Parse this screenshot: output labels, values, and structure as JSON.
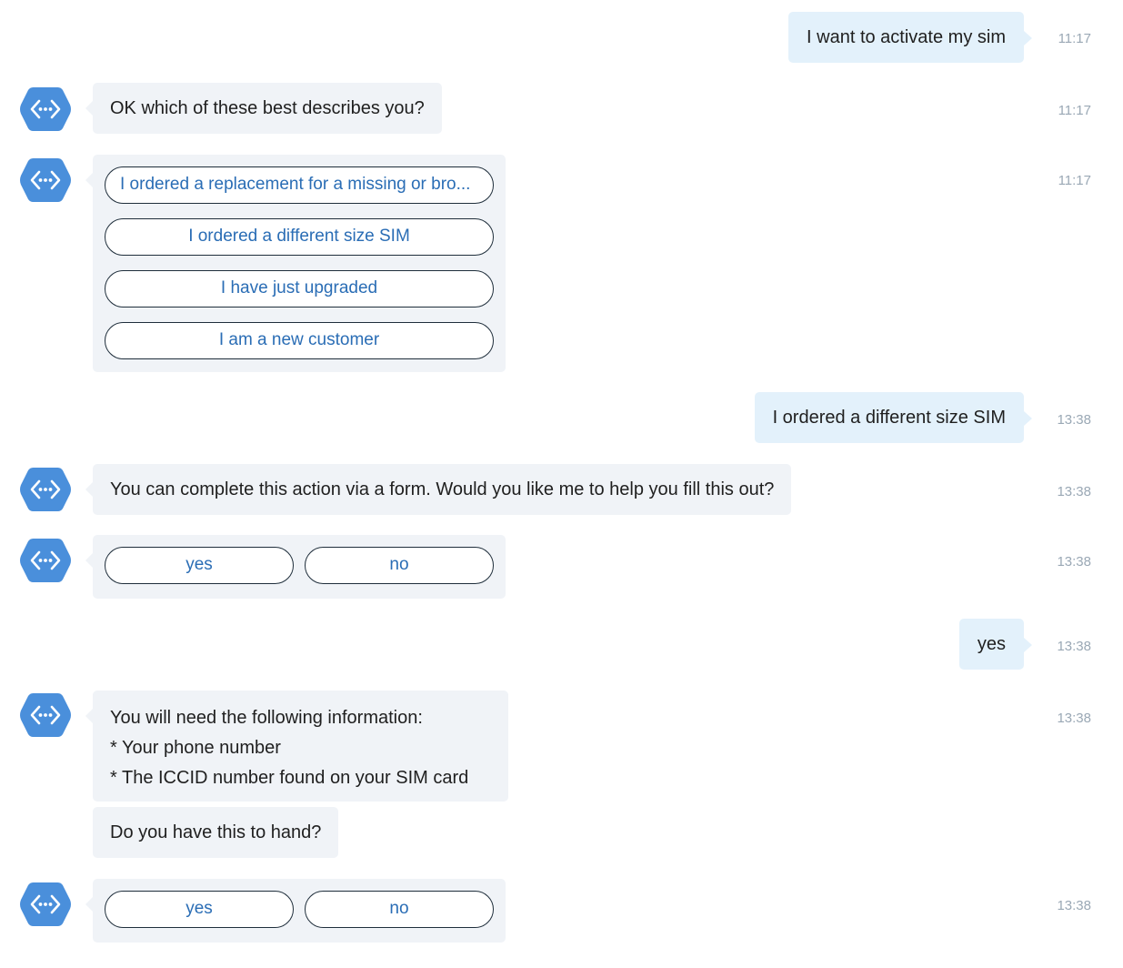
{
  "messages": {
    "m1": {
      "text": "I want to activate my sim",
      "time": "11:17"
    },
    "m2": {
      "text": "OK  which of these best describes you?",
      "time": "11:17"
    },
    "m3": {
      "time": "11:17",
      "options": [
        "I ordered a replacement for a missing or bro...",
        "I ordered a different size SIM",
        "I have just upgraded",
        "I am a new customer"
      ]
    },
    "m4": {
      "text": "I ordered a different size SIM",
      "time": "13:38"
    },
    "m5": {
      "text": "You can complete this action via a form. Would you like me to help you fill this out?",
      "time": "13:38"
    },
    "m6": {
      "time": "13:38",
      "options": [
        "yes",
        "no"
      ]
    },
    "m7": {
      "text": "yes",
      "time": "13:38"
    },
    "m8": {
      "lines": [
        "You will need the following information:",
        "* Your phone number",
        "* The ICCID number found on your SIM card"
      ],
      "time": "13:38"
    },
    "m9": {
      "text": "Do you have this to hand?"
    },
    "m10": {
      "time": "13:38",
      "options": [
        "yes",
        "no"
      ]
    }
  },
  "icons": {
    "bot_avatar": "code-hexagon-icon"
  },
  "colors": {
    "user_bubble": "#e3f1fb",
    "bot_bubble": "#f0f3f7",
    "avatar": "#4a8fdb",
    "option_text": "#2a6db5",
    "timestamp": "#9aa8b5"
  }
}
